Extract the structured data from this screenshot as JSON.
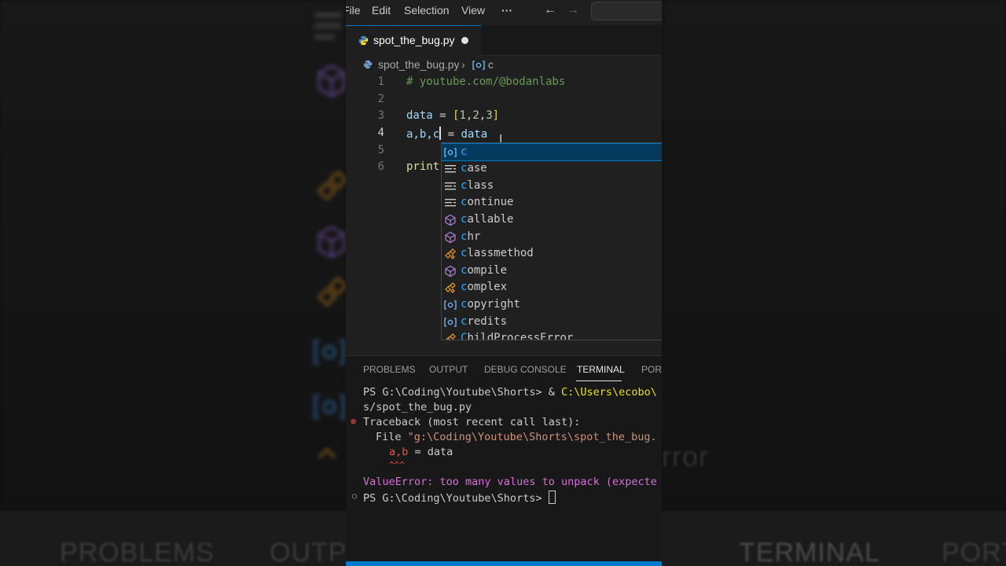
{
  "menu": {
    "file": "File",
    "edit": "Edit",
    "selection": "Selection",
    "view": "View",
    "more": "···",
    "back": "←",
    "forward": "→"
  },
  "tab": {
    "filename": "spot_the_bug.py"
  },
  "breadcrumb": {
    "file": "spot_the_bug.py",
    "sep": "›",
    "symbol": "c"
  },
  "editor": {
    "line_numbers": [
      "1",
      "2",
      "3",
      "4",
      "5",
      "6"
    ],
    "line1_comment": "# youtube.com/@bodanlabs",
    "line3": {
      "var": "data",
      "op": " = ",
      "open": "[",
      "n1": "1",
      "n2": "2",
      "n3": "3",
      "close": "]",
      "comma": ","
    },
    "line4": {
      "vars": "a,b,c",
      "op": " = ",
      "rhs": "data"
    },
    "line6": {
      "fn": "print"
    }
  },
  "suggest": {
    "items": [
      {
        "match": "c",
        "rest": "",
        "kind": "variable"
      },
      {
        "match": "c",
        "rest": "ase",
        "kind": "keyword"
      },
      {
        "match": "c",
        "rest": "lass",
        "kind": "keyword"
      },
      {
        "match": "c",
        "rest": "ontinue",
        "kind": "keyword"
      },
      {
        "match": "c",
        "rest": "allable",
        "kind": "function"
      },
      {
        "match": "c",
        "rest": "hr",
        "kind": "function"
      },
      {
        "match": "c",
        "rest": "lassmethod",
        "kind": "class"
      },
      {
        "match": "c",
        "rest": "ompile",
        "kind": "function"
      },
      {
        "match": "c",
        "rest": "omplex",
        "kind": "class"
      },
      {
        "match": "c",
        "rest": "opyright",
        "kind": "variable"
      },
      {
        "match": "c",
        "rest": "redits",
        "kind": "variable"
      },
      {
        "match": "C",
        "rest": "hildProcessError",
        "kind": "class"
      }
    ]
  },
  "panel": {
    "tabs": [
      "PROBLEMS",
      "OUTPUT",
      "DEBUG CONSOLE",
      "TERMINAL",
      "PORTS"
    ],
    "active_tab": "TERMINAL"
  },
  "terminal": {
    "prompt1_a": "PS G:\\Coding\\Youtube\\Shorts> & ",
    "prompt1_b": "C:\\Users\\ecobo\\",
    "prompt1_c": "s/spot_the_bug.py",
    "traceback": "Traceback (most recent call last):",
    "file_kw": "File ",
    "file_path": "\"g:\\Coding\\Youtube\\Shorts\\spot_the_bug.",
    "code_err": "a,b",
    "code_rest": " = data",
    "carets": "^^^",
    "error_type": "ValueError:",
    "error_msg": " too many values to unpack (expecte",
    "prompt2": "PS G:\\Coding\\Youtube\\Shorts> "
  },
  "background": {
    "labels": [
      "PROBLEMS",
      "OUTP",
      "TERMINAL",
      "PORT"
    ],
    "ghost_text": "rror"
  },
  "colors": {
    "accent": "#007acc",
    "selection": "#04395e",
    "error": "#f14c4c",
    "comment": "#6a9955"
  }
}
